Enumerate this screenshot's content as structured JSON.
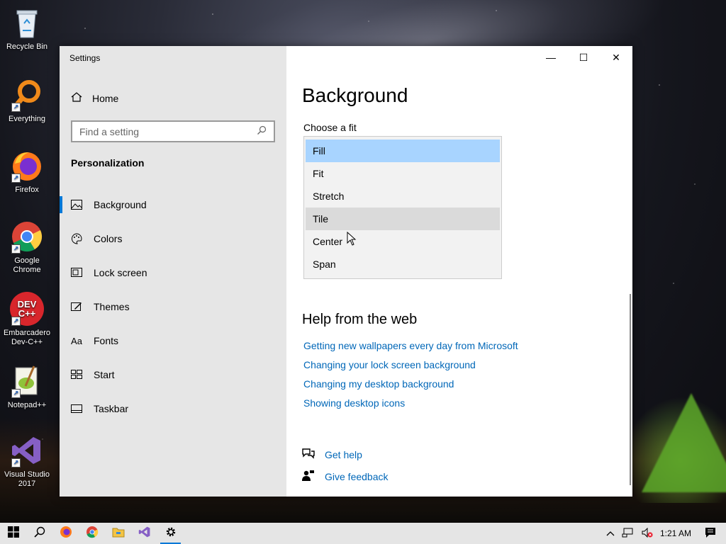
{
  "desktop": {
    "icons": [
      {
        "label": "Recycle Bin",
        "icon": "recycle-bin-icon"
      },
      {
        "label": "Everything",
        "icon": "everything-search-icon"
      },
      {
        "label": "Firefox",
        "icon": "firefox-icon"
      },
      {
        "label": "Google Chrome",
        "icon": "chrome-icon"
      },
      {
        "label": "Embarcadero Dev-C++",
        "icon": "devcpp-icon",
        "glyph_text": "DEV C++"
      },
      {
        "label": "Notepad++",
        "icon": "notepadpp-icon"
      },
      {
        "label": "Visual Studio 2017",
        "icon": "visual-studio-icon"
      }
    ]
  },
  "window": {
    "title": "Settings",
    "caption": {
      "minimize": "—",
      "maximize": "☐",
      "close": "✕"
    },
    "sidebar": {
      "home_label": "Home",
      "search_placeholder": "Find a setting",
      "section_title": "Personalization",
      "items": [
        {
          "label": "Background",
          "icon": "picture-icon",
          "active": true
        },
        {
          "label": "Colors",
          "icon": "palette-icon"
        },
        {
          "label": "Lock screen",
          "icon": "lock-screen-icon"
        },
        {
          "label": "Themes",
          "icon": "themes-icon"
        },
        {
          "label": "Fonts",
          "icon": "fonts-icon"
        },
        {
          "label": "Start",
          "icon": "start-icon"
        },
        {
          "label": "Taskbar",
          "icon": "taskbar-icon"
        }
      ]
    },
    "main": {
      "page_title": "Background",
      "fit_label": "Choose a fit",
      "fit_options": [
        "Fill",
        "Fit",
        "Stretch",
        "Tile",
        "Center",
        "Span"
      ],
      "selected_option": "Fill",
      "hovered_option": "Tile",
      "help_title": "Help from the web",
      "help_links": [
        "Getting new wallpapers every day from Microsoft",
        "Changing your lock screen background",
        "Changing my desktop background",
        "Showing desktop icons"
      ],
      "get_help": "Get help",
      "give_feedback": "Give feedback"
    }
  },
  "taskbar": {
    "apps": [
      "start-icon",
      "search-icon",
      "firefox-icon",
      "chrome-icon",
      "file-explorer-icon",
      "visual-studio-icon",
      "settings-gear-icon"
    ],
    "active_app": "settings-gear-icon",
    "clock": "1:21 AM"
  },
  "colors": {
    "accent": "#0078d7",
    "link": "#0067b8",
    "selected_option": "#a8d4ff",
    "sidebar_bg": "#e6e6e6",
    "taskbar_bg": "#e5e5e5"
  }
}
